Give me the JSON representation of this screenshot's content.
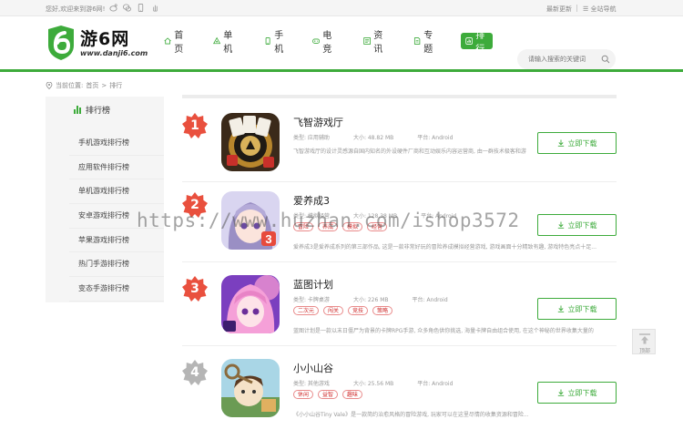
{
  "topbar": {
    "welcome": "您好,欢迎来到游6网!",
    "latest_update": "最新更新",
    "site_nav": "全站导航"
  },
  "brand": {
    "logo_text": "游6网",
    "logo_url": "www.danji6.com",
    "accent": "#3dab3b"
  },
  "nav": {
    "items": [
      {
        "label": "首页",
        "icon": "home-icon"
      },
      {
        "label": "单机",
        "icon": "gamepad-icon"
      },
      {
        "label": "手机",
        "icon": "phone-icon"
      },
      {
        "label": "电竞",
        "icon": "controller-icon"
      },
      {
        "label": "资讯",
        "icon": "news-icon"
      },
      {
        "label": "专题",
        "icon": "topic-icon"
      },
      {
        "label": "排行",
        "icon": "chart-icon",
        "active": true
      }
    ]
  },
  "search": {
    "placeholder": "请输入搜索的关键词"
  },
  "breadcrumb": {
    "prefix": "当前位置:",
    "home": "首页",
    "sep": ">",
    "current": "排行"
  },
  "sidebar": {
    "heading": "排行榜",
    "items": [
      "手机游戏排行榜",
      "应用软件排行榜",
      "单机游戏排行榜",
      "安卓游戏排行榜",
      "苹果游戏排行榜",
      "热门手游排行榜",
      "变态手游排行榜"
    ]
  },
  "download_label": "立即下载",
  "ranking": [
    {
      "rank": "1",
      "rank_color": "#e9503e",
      "name": "飞智游戏厅",
      "type": "类型: 应用辅助",
      "size": "大小: 48.82 MB",
      "platform": "平台: Android",
      "tags": [],
      "desc": "飞智游戏厅的设计灵感源自国内知名的外设硬件厂商和互动娱乐内容运营商, 由一群技术极客和游"
    },
    {
      "rank": "2",
      "rank_color": "#e9503e",
      "name": "爱养成3",
      "type": "类型: 模拟经营",
      "size": "大小: 128.38 MB",
      "platform": "平台: Android",
      "tags": [
        "冒险",
        "养成",
        "模拟",
        "经营"
      ],
      "desc": "爱养成3是爱养成系列的第三部作品, 这是一款非常好玩的冒险养成模拟经营游戏, 游戏画面十分精致有趣, 游戏特色亮点十足..."
    },
    {
      "rank": "3",
      "rank_color": "#e9503e",
      "name": "蓝图计划",
      "type": "类型: 卡牌桌游",
      "size": "大小: 226 MB",
      "platform": "平台: Android",
      "tags": [
        "二次元",
        "闯关",
        "竞技",
        "策略"
      ],
      "desc": "蓝图计划是一款以末日僵尸为背景的卡牌RPG手游, 众多角色供你挑选, 海量卡牌自由组合使用, 在这个神秘的世界收集大量的"
    },
    {
      "rank": "4",
      "rank_color": "#b5b5b5",
      "name": "小小山谷",
      "type": "类型: 其他游戏",
      "size": "大小: 25.56 MB",
      "platform": "平台: Android",
      "tags": [
        "休闲",
        "益智",
        "趣味"
      ],
      "desc": "《小小山谷Tiny Vale》是一款简约治愈风格的冒险游戏, 玩家可以在这里尽情的收集资源和冒险..."
    }
  ],
  "back_to_top": "顶部",
  "watermark": "https://www.huzhan.com/ishop3572"
}
